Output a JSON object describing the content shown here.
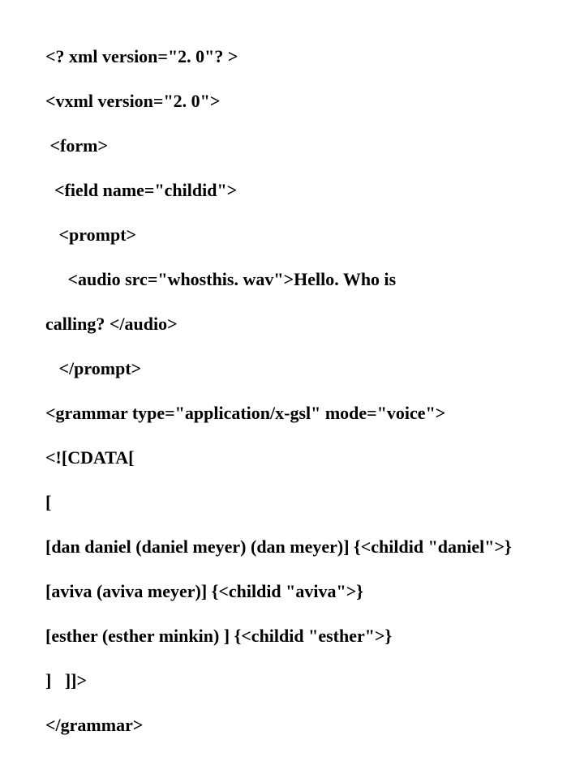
{
  "code": {
    "lines": [
      "<? xml version=\"2. 0\"? >",
      "<vxml version=\"2. 0\">",
      " <form>",
      "  <field name=\"childid\">",
      "   <prompt>",
      "     <audio src=\"whosthis. wav\">Hello. Who is",
      "calling? </audio>",
      "   </prompt>",
      "<grammar type=\"application/x-gsl\" mode=\"voice\">",
      "<![CDATA[",
      "[",
      "[dan daniel (daniel meyer) (dan meyer)] {<childid \"daniel\">}",
      "[aviva (aviva meyer)] {<childid \"aviva\">}",
      "[esther (esther minkin) ] {<childid \"esther\">}",
      "]   ]]>",
      "</grammar>"
    ]
  }
}
